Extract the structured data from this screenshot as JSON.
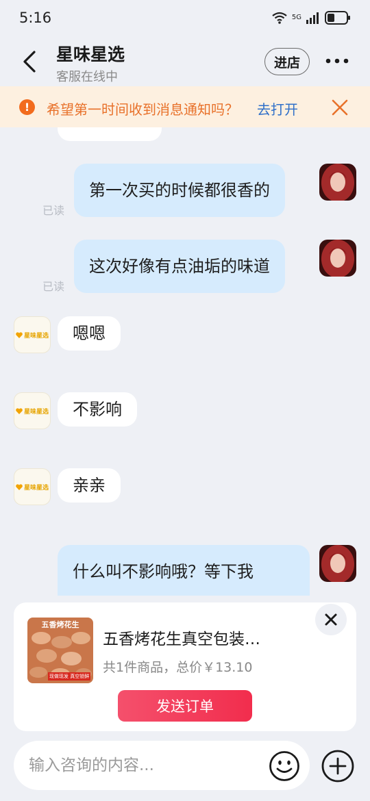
{
  "status_bar": {
    "time": "5:16",
    "network": "5G"
  },
  "header": {
    "title": "星味星选",
    "subtitle": "客服在线中",
    "enter_shop_label": "进店"
  },
  "notification": {
    "text": "希望第一时间收到消息通知吗？",
    "link": "去打开"
  },
  "shop": {
    "logo_text": "星味星选"
  },
  "messages": [
    {
      "side": "out",
      "text": "第一次买的时候都很香的",
      "read": "已读"
    },
    {
      "side": "out",
      "text": "这次好像有点油垢的味道",
      "read": "已读"
    },
    {
      "side": "in",
      "text": "嗯嗯"
    },
    {
      "side": "in",
      "text": "不影响"
    },
    {
      "side": "in",
      "text": "亲亲"
    },
    {
      "side": "out",
      "text": "什么叫不影响哦？等下我"
    }
  ],
  "order_card": {
    "thumb_label": "五香烤花生",
    "thumb_tag": "现做现发 真空锁鲜",
    "product_title": "五香烤花生真空包装…",
    "summary": "共1件商品，总价￥13.10",
    "send_label": "发送订单"
  },
  "input": {
    "placeholder": "输入咨询的内容..."
  },
  "colors": {
    "accent": "#f22d4d",
    "bubble_out": "#d6ebfd",
    "banner_text": "#e8712a",
    "link": "#2f6fc9"
  }
}
